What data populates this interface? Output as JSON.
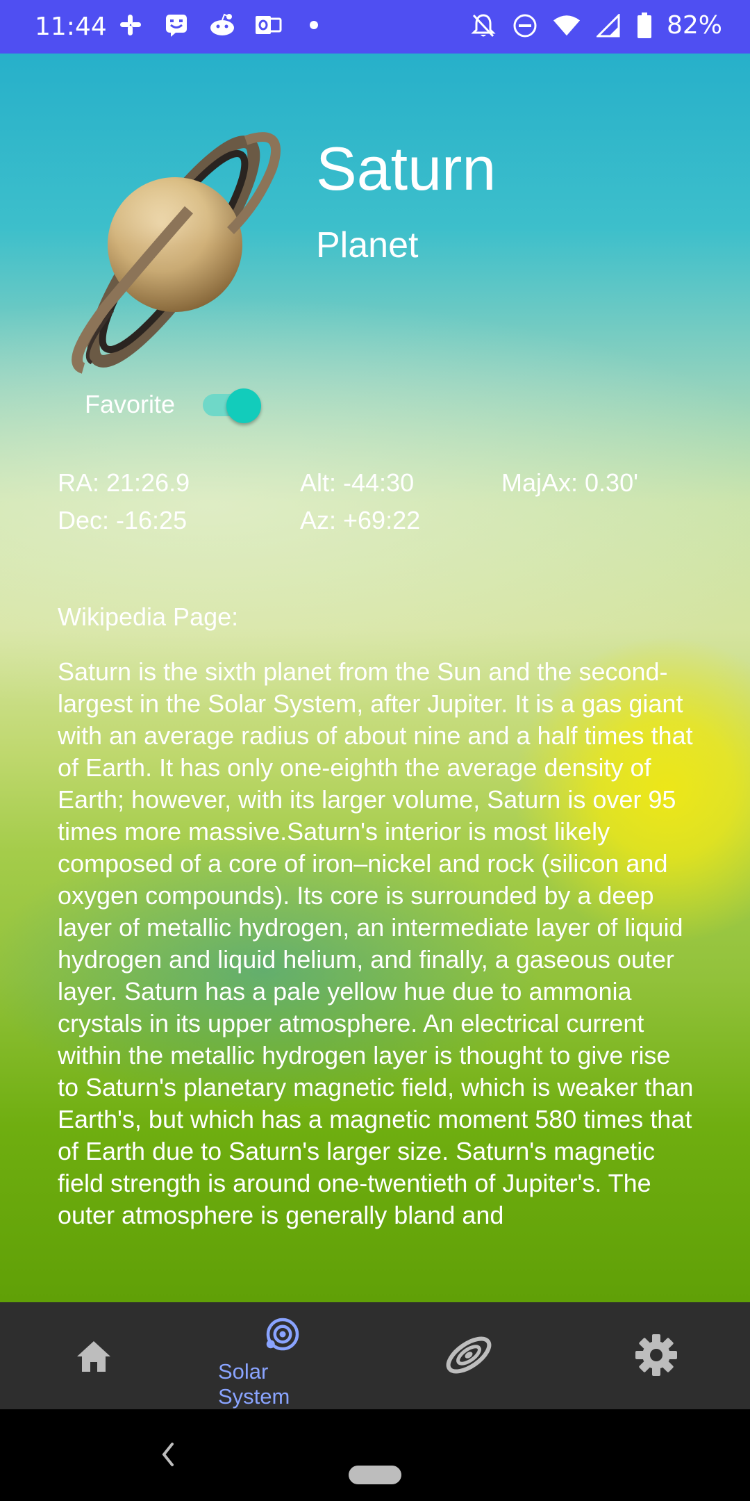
{
  "status_bar": {
    "time": "11:44",
    "left_icons": [
      "slack-icon",
      "chat-icon",
      "reddit-icon",
      "outlook-icon",
      "dot-icon"
    ],
    "right_icons": [
      "notifications-off-icon",
      "do-not-disturb-icon",
      "wifi-icon",
      "signal-icon",
      "battery-icon"
    ],
    "battery": "82%"
  },
  "object": {
    "name": "Saturn",
    "type": "Planet",
    "favorite_label": "Favorite",
    "favorite_on": true
  },
  "coordinates": {
    "ra": "RA: 21:26.9",
    "dec": "Dec: -16:25",
    "alt": "Alt: -44:30",
    "az": "Az: +69:22",
    "majax": "MajAx: 0.30'"
  },
  "wikipedia": {
    "label": "Wikipedia Page:",
    "text": "Saturn is the sixth planet from the Sun and the second-largest in the Solar System, after Jupiter. It is a gas giant with an average radius of about nine and a half times that of Earth. It has only one-eighth the average density of Earth; however, with its larger volume, Saturn is over 95 times more massive.Saturn's interior is most likely composed of a core of iron–nickel and rock (silicon and oxygen compounds). Its core is surrounded by a deep layer of metallic hydrogen, an intermediate layer of liquid hydrogen and liquid helium, and finally, a gaseous outer layer. Saturn has a pale yellow hue due to ammonia crystals in its upper atmosphere. An electrical current within the metallic hydrogen layer is thought to give rise to Saturn's planetary magnetic field, which is weaker than Earth's, but which has a magnetic moment 580 times that of Earth due to Saturn's larger size. Saturn's magnetic field strength is around one-twentieth of Jupiter's. The outer atmosphere is generally bland and"
  },
  "bottom_nav": {
    "items": [
      {
        "icon": "home-icon",
        "label": ""
      },
      {
        "icon": "solar-system-icon",
        "label": "Solar System",
        "selected": true
      },
      {
        "icon": "galaxy-icon",
        "label": ""
      },
      {
        "icon": "settings-icon",
        "label": ""
      }
    ]
  },
  "colors": {
    "status_bar": "#4F4FF2",
    "accent": "#8AA4FF",
    "toggle": "#12CCBB",
    "nav_background": "#2E2E2E"
  }
}
